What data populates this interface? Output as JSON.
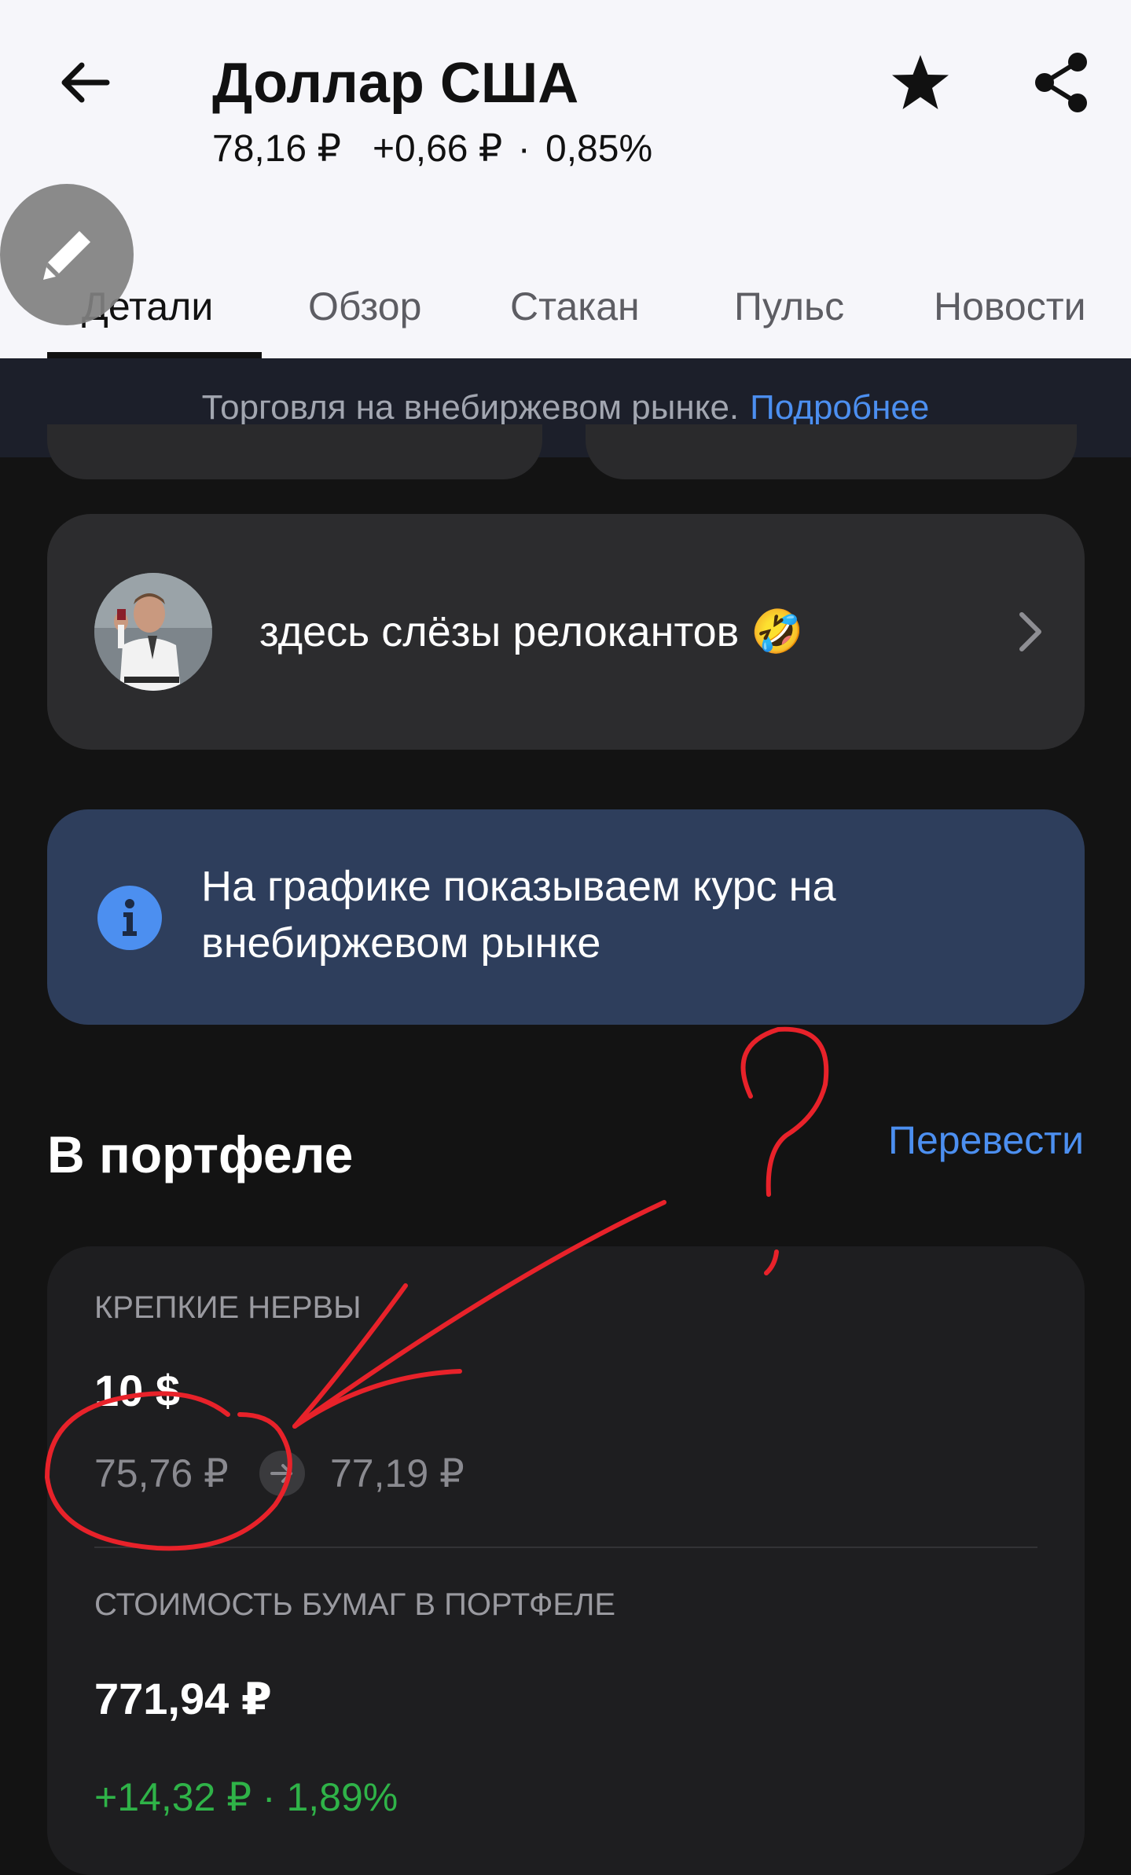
{
  "header": {
    "title": "Доллар США",
    "price": "78,16 ₽",
    "change_abs": "+0,66 ₽",
    "separator": "·",
    "change_pct": "0,85%",
    "icons": {
      "back": "arrow-left-icon",
      "favorite": "star-icon",
      "share": "share-icon",
      "edit": "pencil-icon"
    }
  },
  "tabs": [
    {
      "label": "Детали",
      "active": true
    },
    {
      "label": "Обзор",
      "active": false
    },
    {
      "label": "Стакан",
      "active": false
    },
    {
      "label": "Пульс",
      "active": false
    },
    {
      "label": "Новости",
      "active": false
    }
  ],
  "banner": {
    "text": "Торговля на внебиржевом рынке.",
    "link": "Подробнее"
  },
  "pulse": {
    "text": "здесь слёзы релокантов 🤣"
  },
  "info": {
    "text": "На графике показываем курс на внебиржевом рынке"
  },
  "portfolio": {
    "title": "В портфеле",
    "transfer_label": "Перевести",
    "account_name": "КРЕПКИЕ НЕРВЫ",
    "amount": "10 $",
    "rate_from": "75,76 ₽",
    "rate_to": "77,19 ₽",
    "value_label": "СТОИМОСТЬ БУМАГ В ПОРТФЕЛЕ",
    "value": "771,94 ₽",
    "value_change": "+14,32 ₽ · 1,89%"
  },
  "colors": {
    "header_bg": "#f6f6fa",
    "page_bg": "#131313",
    "banner_bg": "#1c1f2a",
    "link_blue": "#4c8ff0",
    "info_bg": "#2e3e5c",
    "gain_green": "#2fb348",
    "annotation_red": "#e8222a"
  }
}
